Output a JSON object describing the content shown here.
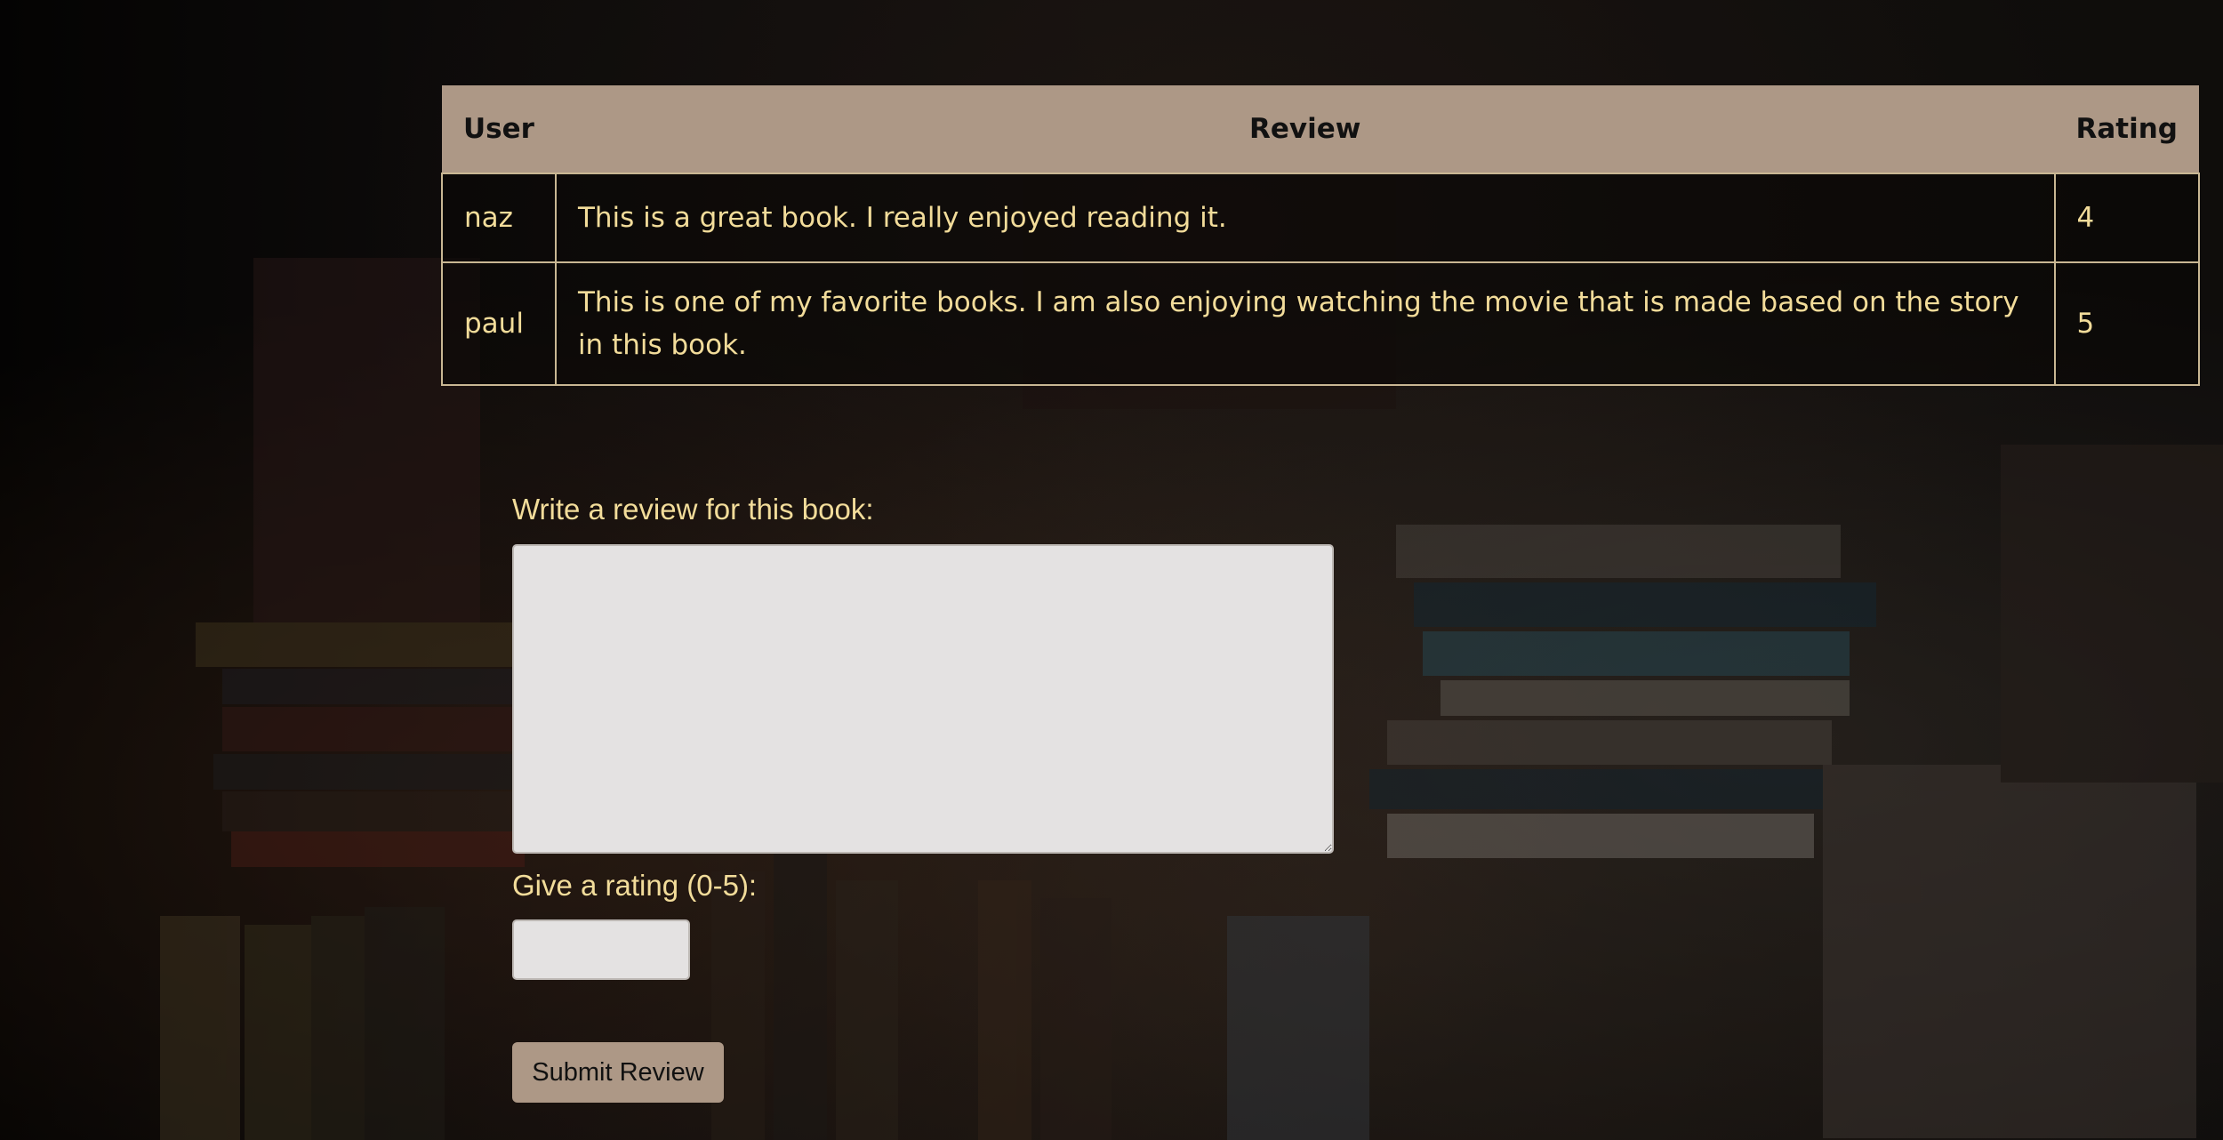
{
  "reviews_table": {
    "headers": {
      "user": "User",
      "review": "Review",
      "rating": "Rating"
    },
    "rows": [
      {
        "user": "naz",
        "review": "This is a great book. I really enjoyed reading it.",
        "rating": "4"
      },
      {
        "user": "paul",
        "review": "This is one of my favorite books. I am also enjoying watching the movie that is made based on the story in this book.",
        "rating": "5"
      }
    ]
  },
  "review_form": {
    "review_label": "Write a review for this book:",
    "review_value": "",
    "rating_label": "Give a rating (0-5):",
    "rating_value": "",
    "submit_label": "Submit Review"
  },
  "colors": {
    "accent": "#ad9886",
    "text": "#f2dc9a",
    "input_background": "#e4e2e2"
  }
}
